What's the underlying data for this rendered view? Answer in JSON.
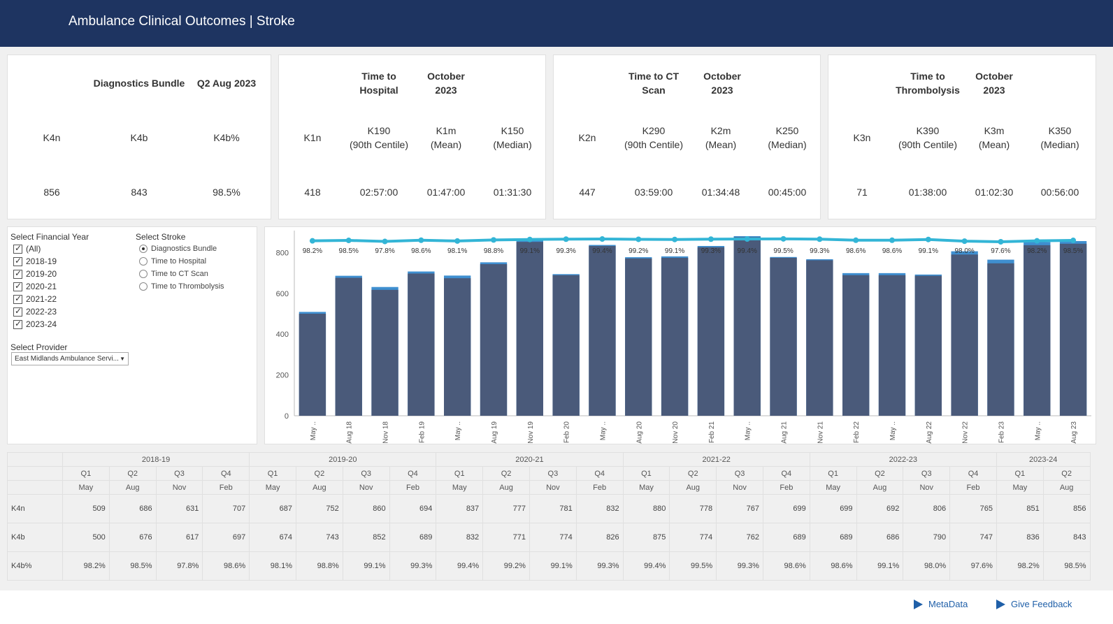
{
  "header": {
    "title": "Ambulance Clinical Outcomes | Stroke"
  },
  "kpi": {
    "diagnostics": {
      "title": "Diagnostics Bundle",
      "period": "Q2 Aug 2023",
      "headers": [
        "K4n",
        "K4b",
        "K4b%"
      ],
      "values": [
        "856",
        "843",
        "98.5%"
      ]
    },
    "hospital": {
      "title_1": "Time to",
      "title_2": "Hospital",
      "period_1": "October",
      "period_2": "2023",
      "headers": [
        [
          "K1n",
          ""
        ],
        [
          "K190",
          "(90th Centile)"
        ],
        [
          "K1m",
          "(Mean)"
        ],
        [
          "K150",
          "(Median)"
        ]
      ],
      "values": [
        "418",
        "02:57:00",
        "01:47:00",
        "01:31:30"
      ]
    },
    "ct": {
      "title_1": "Time to CT",
      "title_2": "Scan",
      "period_1": "October",
      "period_2": "2023",
      "headers": [
        [
          "K2n",
          ""
        ],
        [
          "K290",
          "(90th Centile)"
        ],
        [
          "K2m",
          "(Mean)"
        ],
        [
          "K250",
          "(Median)"
        ]
      ],
      "values": [
        "447",
        "03:59:00",
        "01:34:48",
        "00:45:00"
      ]
    },
    "thrombolysis": {
      "title_1": "Time to",
      "title_2": "Thrombolysis",
      "period_1": "October",
      "period_2": "2023",
      "headers": [
        [
          "K3n",
          ""
        ],
        [
          "K390",
          "(90th Centile)"
        ],
        [
          "K3m",
          "(Mean)"
        ],
        [
          "K350",
          "(Median)"
        ]
      ],
      "values": [
        "71",
        "01:38:00",
        "01:02:30",
        "00:56:00"
      ]
    }
  },
  "filters": {
    "year_label": "Select Financial Year",
    "years": [
      "(All)",
      "2018-19",
      "2019-20",
      "2020-21",
      "2021-22",
      "2022-23",
      "2023-24"
    ],
    "stroke_label": "Select Stroke",
    "stroke_options": [
      "Diagnostics Bundle",
      "Time to Hospital",
      "Time to CT Scan",
      "Time to Thrombolysis"
    ],
    "stroke_selected": "Diagnostics Bundle",
    "provider_label": "Select Provider",
    "provider_value": "East Midlands Ambulance Servi..."
  },
  "chart_data": {
    "type": "bar",
    "categories": [
      "May ..",
      "Aug 18",
      "Nov 18",
      "Feb 19",
      "May ..",
      "Aug 19",
      "Nov 19",
      "Feb 20",
      "May ..",
      "Aug 20",
      "Nov 20",
      "Feb 21",
      "May ..",
      "Aug 21",
      "Nov 21",
      "Feb 22",
      "May ..",
      "Aug 22",
      "Nov 22",
      "Feb 23",
      "May ..",
      "Aug 23"
    ],
    "series": [
      {
        "values": [
          509,
          686,
          631,
          707,
          687,
          752,
          860,
          694,
          837,
          777,
          781,
          832,
          880,
          778,
          767,
          699,
          699,
          692,
          806,
          765,
          851,
          856
        ]
      },
      {
        "values": [
          500,
          676,
          617,
          697,
          674,
          743,
          852,
          689,
          832,
          771,
          774,
          826,
          875,
          774,
          762,
          689,
          689,
          686,
          790,
          747,
          836,
          843
        ]
      },
      {
        "values": [
          98.2,
          98.5,
          97.8,
          98.6,
          98.1,
          98.8,
          99.1,
          99.3,
          99.4,
          99.2,
          99.1,
          99.3,
          99.4,
          99.5,
          99.3,
          98.6,
          98.6,
          99.1,
          98.0,
          97.6,
          98.2,
          98.5
        ]
      }
    ],
    "data_labels": [
      "98.2%",
      "98.5%",
      "97.8%",
      "98.6%",
      "98.1%",
      "98.8%",
      "99.1%",
      "99.3%",
      "99.4%",
      "99.2%",
      "99.1%",
      "99.3%",
      "99.4%",
      "99.5%",
      "99.3%",
      "98.6%",
      "98.6%",
      "99.1%",
      "98.0%",
      "97.6%",
      "98.2%",
      "98.5%"
    ],
    "yticks": [
      "800",
      "600",
      "400",
      "200",
      "0"
    ],
    "ylim": [
      0,
      880
    ],
    "grid": false,
    "colors": {
      "bar": "#4a5a7a",
      "bar_top": "#3f8fd0",
      "line": "#33b5d6"
    }
  },
  "table": {
    "years": [
      "2018-19",
      "2019-20",
      "2020-21",
      "2021-22",
      "2022-23",
      "2023-24"
    ],
    "quarters": [
      "Q1",
      "Q2",
      "Q3",
      "Q4",
      "Q1",
      "Q2",
      "Q3",
      "Q4",
      "Q1",
      "Q2",
      "Q3",
      "Q4",
      "Q1",
      "Q2",
      "Q3",
      "Q4",
      "Q1",
      "Q2",
      "Q3",
      "Q4",
      "Q1",
      "Q2"
    ],
    "months": [
      "May",
      "Aug",
      "Nov",
      "Feb",
      "May",
      "Aug",
      "Nov",
      "Feb",
      "May",
      "Aug",
      "Nov",
      "Feb",
      "May",
      "Aug",
      "Nov",
      "Feb",
      "May",
      "Aug",
      "Nov",
      "Feb",
      "May",
      "Aug"
    ],
    "rows": [
      {
        "label": "K4n",
        "values": [
          "509",
          "686",
          "631",
          "707",
          "687",
          "752",
          "860",
          "694",
          "837",
          "777",
          "781",
          "832",
          "880",
          "778",
          "767",
          "699",
          "699",
          "692",
          "806",
          "765",
          "851",
          "856"
        ]
      },
      {
        "label": "K4b",
        "values": [
          "500",
          "676",
          "617",
          "697",
          "674",
          "743",
          "852",
          "689",
          "832",
          "771",
          "774",
          "826",
          "875",
          "774",
          "762",
          "689",
          "689",
          "686",
          "790",
          "747",
          "836",
          "843"
        ]
      },
      {
        "label": "K4b%",
        "values": [
          "98.2%",
          "98.5%",
          "97.8%",
          "98.6%",
          "98.1%",
          "98.8%",
          "99.1%",
          "99.3%",
          "99.4%",
          "99.2%",
          "99.1%",
          "99.3%",
          "99.4%",
          "99.5%",
          "99.3%",
          "98.6%",
          "98.6%",
          "99.1%",
          "98.0%",
          "97.6%",
          "98.2%",
          "98.5%"
        ]
      }
    ]
  },
  "footer": {
    "metadata_label": "MetaData",
    "feedback_label": "Give Feedback"
  }
}
